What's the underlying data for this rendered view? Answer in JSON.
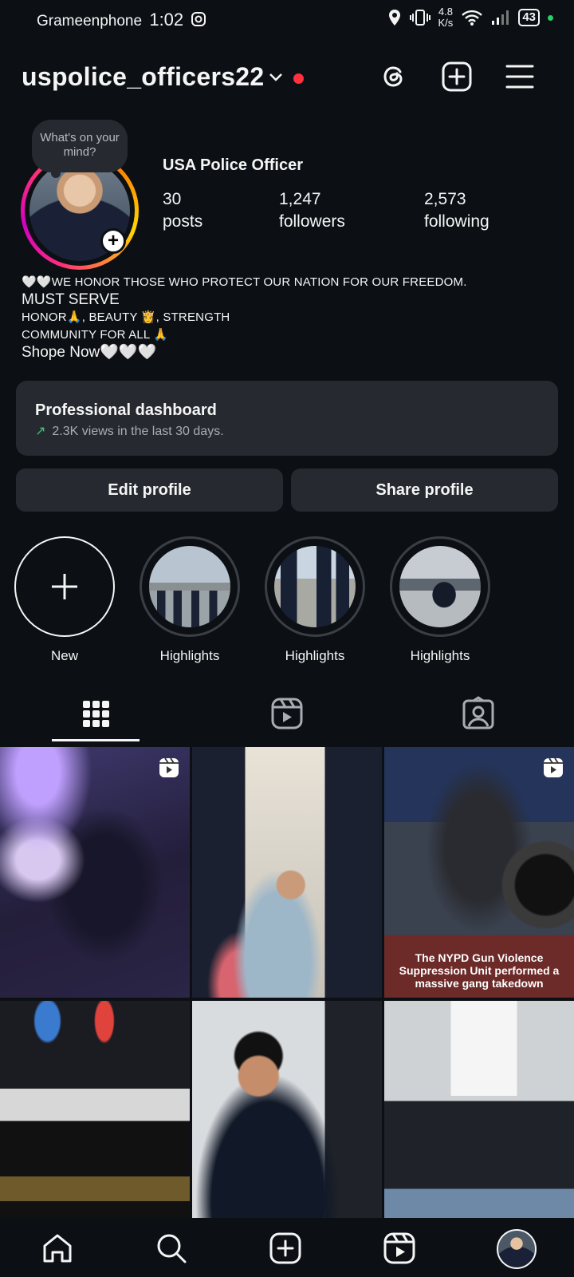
{
  "status_bar": {
    "carrier": "Grameenphone",
    "time": "1:02",
    "speed_value": "4.8",
    "speed_unit": "K/s",
    "battery": "43"
  },
  "header": {
    "username": "uspolice_officers22",
    "icons": [
      "threads-icon",
      "create-icon",
      "menu-icon"
    ]
  },
  "profile": {
    "note_bubble": "What's on your mind?",
    "display_name": "USA Police Officer",
    "stats": [
      {
        "value": "30",
        "label": "posts"
      },
      {
        "value": "1,247",
        "label": "followers"
      },
      {
        "value": "2,573",
        "label": "following"
      }
    ],
    "bio": [
      "🤍🤍WE HONOR THOSE WHO PROTECT OUR NATION FOR OUR FREEDOM.",
      "MUST SERVE",
      "HONOR🙏, BEAUTY 👸, STRENGTH",
      "COMMUNITY FOR ALL 🙏",
      "Shope Now🤍🤍🤍"
    ]
  },
  "dashboard": {
    "title": "Professional dashboard",
    "subtitle": "2.3K views in the last 30 days."
  },
  "buttons": {
    "edit": "Edit profile",
    "share": "Share profile"
  },
  "highlights": [
    {
      "label": "New"
    },
    {
      "label": "Highlights"
    },
    {
      "label": "Highlights"
    },
    {
      "label": "Highlights"
    }
  ],
  "tabs": [
    "posts-grid-tab",
    "reels-tab",
    "tagged-tab"
  ],
  "grid_captions": {
    "post3": "The NYPD Gun Violence Suppression Unit performed a massive gang takedown"
  },
  "bottom_nav": [
    "home-icon",
    "search-icon",
    "create-icon",
    "reels-icon",
    "profile-avatar"
  ],
  "colors": {
    "background": "#0c1014",
    "card": "#262a30",
    "accent_red": "#ff3040",
    "trend_green": "#3dc97a"
  }
}
